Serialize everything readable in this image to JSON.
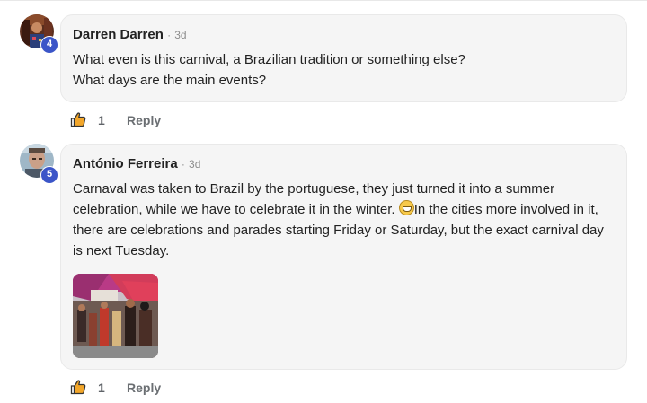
{
  "comments": [
    {
      "author": "Darren Darren",
      "separator": "·",
      "time": "3d",
      "level": "4",
      "lines": [
        "What even is this carnival, a Brazilian tradition or something else?",
        "What days are the main events?"
      ],
      "likes": "1",
      "reply_label": "Reply"
    },
    {
      "author": "António Ferreira",
      "separator": "·",
      "time": "3d",
      "level": "5",
      "lines": [
        "Carnaval was taken to Brazil by the portuguese, they just turned it into a summer",
        "celebration, while we have to celebrate it in the winter. ",
        "In the cities more involved in it,",
        "there are celebrations and parades starting Friday or Saturday, but the exact carnival day",
        "is next Tuesday."
      ],
      "emoji": "grinning-face",
      "likes": "1",
      "reply_label": "Reply"
    }
  ],
  "colors": {
    "badge": "#3b55c8",
    "bubble_bg": "#f5f5f5",
    "like_icon": "#f2a62a"
  }
}
